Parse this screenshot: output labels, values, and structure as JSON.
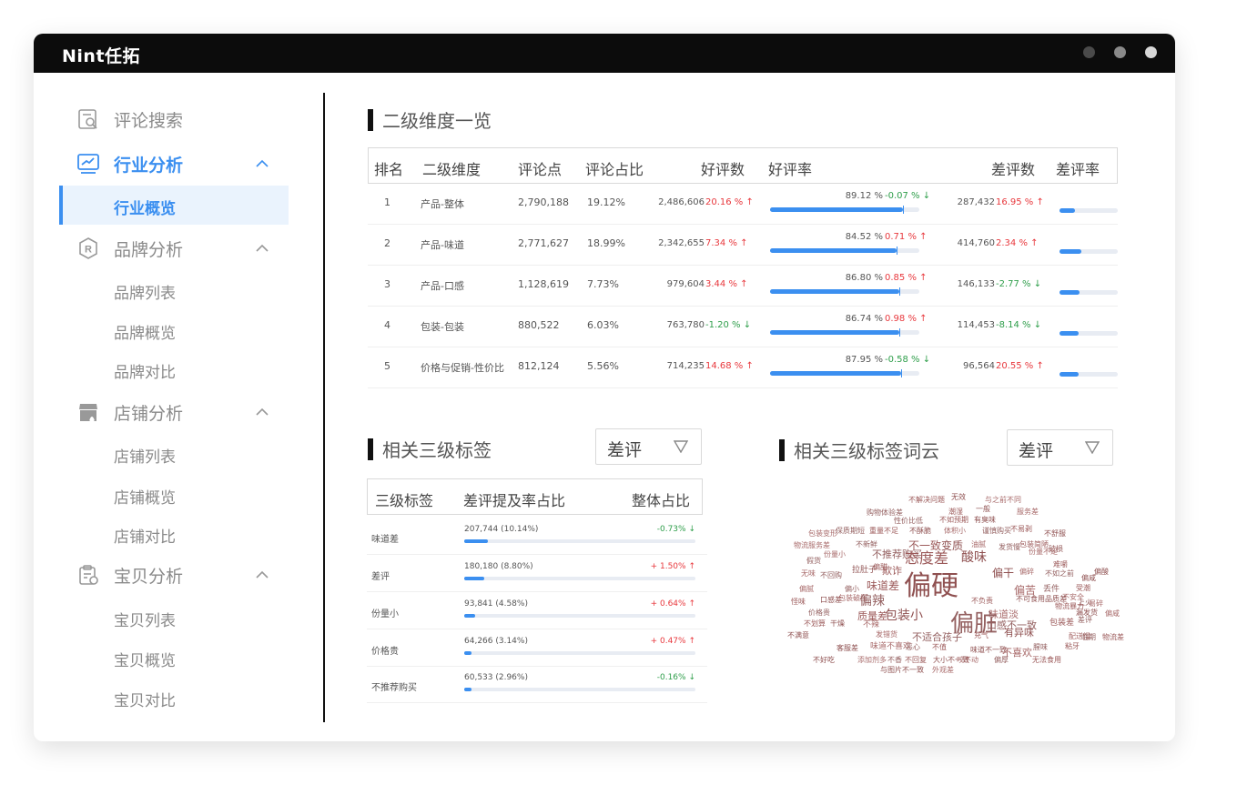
{
  "app": {
    "logo": "Nint任拓",
    "window_dots": [
      "#4a4a4a",
      "#8a8a8a",
      "#d8d8d8"
    ]
  },
  "sidebar": {
    "groups": [
      {
        "label": "评论搜索",
        "icon": "search-doc-icon",
        "active": false
      },
      {
        "label": "行业分析",
        "icon": "trend-chart-icon",
        "active": true
      },
      {
        "label": "品牌分析",
        "icon": "brand-r-icon",
        "active": false
      },
      {
        "label": "店铺分析",
        "icon": "store-icon",
        "active": false
      },
      {
        "label": "宝贝分析",
        "icon": "product-clipboard-icon",
        "active": false
      }
    ],
    "industry_sub": [
      "行业概览"
    ],
    "brand_sub": [
      "品牌列表",
      "品牌概览",
      "品牌对比"
    ],
    "store_sub": [
      "店铺列表",
      "店铺概览",
      "店铺对比"
    ],
    "product_sub": [
      "宝贝列表",
      "宝贝概览",
      "宝贝对比"
    ]
  },
  "dim2": {
    "title": "二级维度一览",
    "headers": [
      "排名",
      "二级维度",
      "评论点",
      "评论占比",
      "好评数",
      "好评率",
      "差评数",
      "差评率"
    ],
    "rows": [
      {
        "rank": "1",
        "name": "产品-整体",
        "points": "2,790,188",
        "share": "19.12%",
        "good": "2,486,606",
        "good_chg": "20.16 % ↑",
        "good_dir": "up",
        "good_rate": "89.12 %",
        "good_rate_chg": "-0.07 % ↓",
        "good_rate_dir": "down",
        "good_rate_val": 0.8912,
        "bad": "287,432",
        "bad_chg": "16.95 % ↑",
        "bad_dir": "up",
        "bad_rate_val": 0.26
      },
      {
        "rank": "2",
        "name": "产品-味道",
        "points": "2,771,627",
        "share": "18.99%",
        "good": "2,342,655",
        "good_chg": "7.34 % ↑",
        "good_dir": "up",
        "good_rate": "84.52 %",
        "good_rate_chg": "0.71 % ↑",
        "good_rate_dir": "up",
        "good_rate_val": 0.8452,
        "bad": "414,760",
        "bad_chg": "2.34 % ↑",
        "bad_dir": "up",
        "bad_rate_val": 0.38
      },
      {
        "rank": "3",
        "name": "产品-口感",
        "points": "1,128,619",
        "share": "7.73%",
        "good": "979,604",
        "good_chg": "3.44 % ↑",
        "good_dir": "up",
        "good_rate": "86.80 %",
        "good_rate_chg": "0.85 % ↑",
        "good_rate_dir": "up",
        "good_rate_val": 0.868,
        "bad": "146,133",
        "bad_chg": "-2.77 % ↓",
        "bad_dir": "down",
        "bad_rate_val": 0.34
      },
      {
        "rank": "4",
        "name": "包装-包装",
        "points": "880,522",
        "share": "6.03%",
        "good": "763,780",
        "good_chg": "-1.20 % ↓",
        "good_dir": "down",
        "good_rate": "86.74 %",
        "good_rate_chg": "0.98 % ↑",
        "good_rate_dir": "up",
        "good_rate_val": 0.8674,
        "bad": "114,453",
        "bad_chg": "-8.14 % ↓",
        "bad_dir": "down",
        "bad_rate_val": 0.33
      },
      {
        "rank": "5",
        "name": "价格与促销-性价比",
        "points": "812,124",
        "share": "5.56%",
        "good": "714,235",
        "good_chg": "14.68 % ↑",
        "good_dir": "up",
        "good_rate": "87.95 %",
        "good_rate_chg": "-0.58 % ↓",
        "good_rate_dir": "down",
        "good_rate_val": 0.8795,
        "bad": "96,564",
        "bad_chg": "20.55 % ↑",
        "bad_dir": "up",
        "bad_rate_val": 0.33
      }
    ]
  },
  "tags3": {
    "title": "相关三级标签",
    "select": "差评",
    "headers": [
      "三级标签",
      "差评提及率占比",
      "整体占比"
    ],
    "rows": [
      {
        "name": "味道差",
        "value": "207,744 (10.14%)",
        "ratio": 0.1014,
        "total_chg": "-0.73% ↓",
        "dir": "down"
      },
      {
        "name": "差评",
        "value": "180,180 (8.80%)",
        "ratio": 0.088,
        "total_chg": "+ 1.50% ↑",
        "dir": "up"
      },
      {
        "name": "份量小",
        "value": "93,841 (4.58%)",
        "ratio": 0.0458,
        "total_chg": "+ 0.64% ↑",
        "dir": "up"
      },
      {
        "name": "价格贵",
        "value": "64,266 (3.14%)",
        "ratio": 0.0314,
        "total_chg": "+ 0.47% ↑",
        "dir": "up"
      },
      {
        "name": "不推荐购买",
        "value": "60,533 (2.96%)",
        "ratio": 0.0296,
        "total_chg": "-0.16% ↓",
        "dir": "down"
      }
    ]
  },
  "cloud": {
    "title": "相关三级标签词云",
    "select": "差评",
    "words": [
      "不解决问题",
      "无效",
      "与之前不同",
      "购物体验差",
      "潮湿",
      "一般",
      "服务差",
      "性价比低",
      "不如预期",
      "有臭味",
      "包装变形",
      "保质期短",
      "重量不足",
      "不酥脆",
      "体积小",
      "谨慎购买",
      "不易剥",
      "不舒服",
      "物流服务差",
      "不新鲜",
      "不一致",
      "变质",
      "油腻",
      "发货慢",
      "包装简陋",
      "破损",
      "份量小",
      "不推荐购买",
      "态度差",
      "酸味",
      "份量不足",
      "假货",
      "偏甜",
      "拉肚子",
      "无味",
      "不回购",
      "欺诈",
      "偏干",
      "偏碎",
      "不如之前",
      "难嚼",
      "偏酸",
      "偏腻",
      "偏小",
      "味道差",
      "偏硬",
      "偏苦",
      "丢件",
      "受潮",
      "偏咸",
      "不安全",
      "上火",
      "怪味",
      "口感差",
      "包装破损",
      "偏辣",
      "不负责",
      "不可食用品质差",
      "易碎",
      "价格贵",
      "质量差",
      "包装小",
      "味道淡",
      "偏脏",
      "物流暴力",
      "漏发货",
      "偏咸",
      "差评",
      "不划算",
      "干燥",
      "不辣",
      "口感不一致",
      "包装差",
      "不满意",
      "发错货",
      "不适合孩子",
      "充气",
      "有异味",
      "配送慢",
      "临期",
      "物流差",
      "客服差",
      "味道不喜欢",
      "恶心",
      "不值",
      "味道不一致",
      "不喜欢",
      "腥味",
      "粘牙",
      "不好吃",
      "添加剂多",
      "不香",
      "不回复",
      "大小不一致",
      "咬不动",
      "偏厚",
      "无法食用",
      "与图片不一致",
      "外观差"
    ]
  }
}
